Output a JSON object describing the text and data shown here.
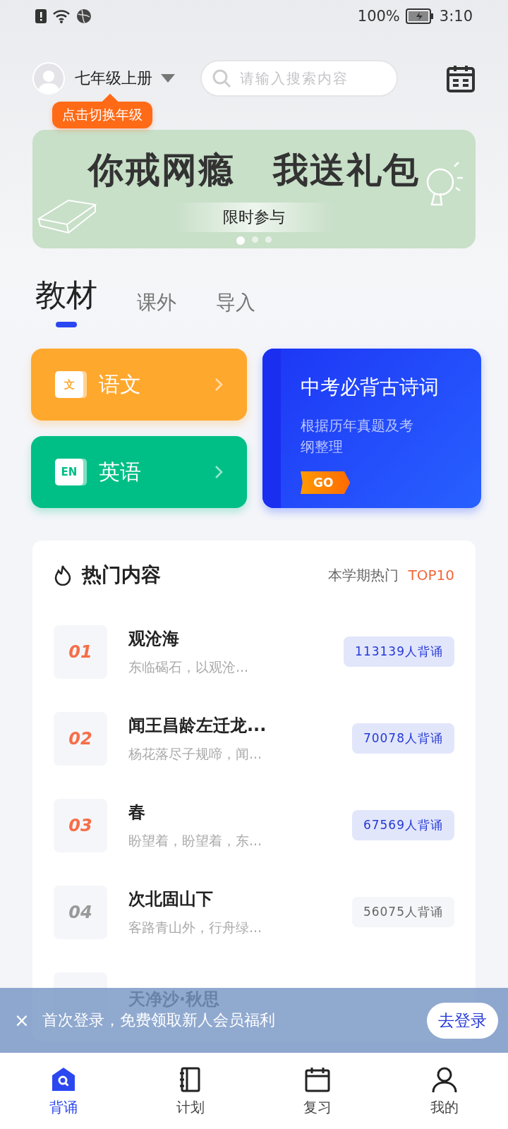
{
  "status_bar": {
    "battery": "100%",
    "time": "3:10"
  },
  "header": {
    "grade": "七年级上册",
    "search": {
      "placeholder": "请输入搜索内容"
    }
  },
  "tooltip": "点击切换年级",
  "banner": {
    "headline": [
      "你戒网瘾",
      "我送礼包"
    ],
    "button": "限时参与",
    "dots": [
      {
        "selected": true
      },
      {
        "selected": false
      },
      {
        "selected": false
      }
    ]
  },
  "tabs": [
    {
      "label": "教材",
      "selected": true
    },
    {
      "label": "课外",
      "selected": false
    },
    {
      "label": "导入",
      "selected": false
    }
  ],
  "subjects": [
    {
      "icon_text": "文",
      "name": "语文",
      "color": "#ffa82e"
    },
    {
      "icon_text": "EN",
      "name": "英语",
      "color": "#00bf86"
    }
  ],
  "promo": {
    "title": "中考必背古诗词",
    "subtitle": "根据历年真题及考纲整理",
    "button": "GO"
  },
  "hot": {
    "title": "热门内容",
    "term": "本学期热门",
    "rank_label": "TOP10",
    "items": [
      {
        "rank": "01",
        "title": "观沧海",
        "excerpt": "东临碣石，以观沧...",
        "count": "113139人背诵",
        "highlighted": true
      },
      {
        "rank": "02",
        "title": "闻王昌龄左迁龙...",
        "excerpt": "杨花落尽子规啼，闻...",
        "count": "70078人背诵",
        "highlighted": true
      },
      {
        "rank": "03",
        "title": "春",
        "excerpt": "盼望着，盼望着，东...",
        "count": "67569人背诵",
        "highlighted": true
      },
      {
        "rank": "04",
        "title": "次北固山下",
        "excerpt": "客路青山外，行舟绿...",
        "count": "56075人背诵",
        "highlighted": false
      },
      {
        "title": "天净沙·秋思"
      }
    ]
  },
  "login_bar": {
    "close": "×",
    "text": "首次登录，免费领取新人会员福利",
    "button": "去登录"
  },
  "nav": [
    {
      "label": "背诵",
      "kind": "home",
      "selected": true
    },
    {
      "label": "计划",
      "kind": "plan",
      "selected": false
    },
    {
      "label": "复习",
      "kind": "review",
      "selected": false
    },
    {
      "label": "我的",
      "kind": "profile",
      "selected": false
    }
  ]
}
